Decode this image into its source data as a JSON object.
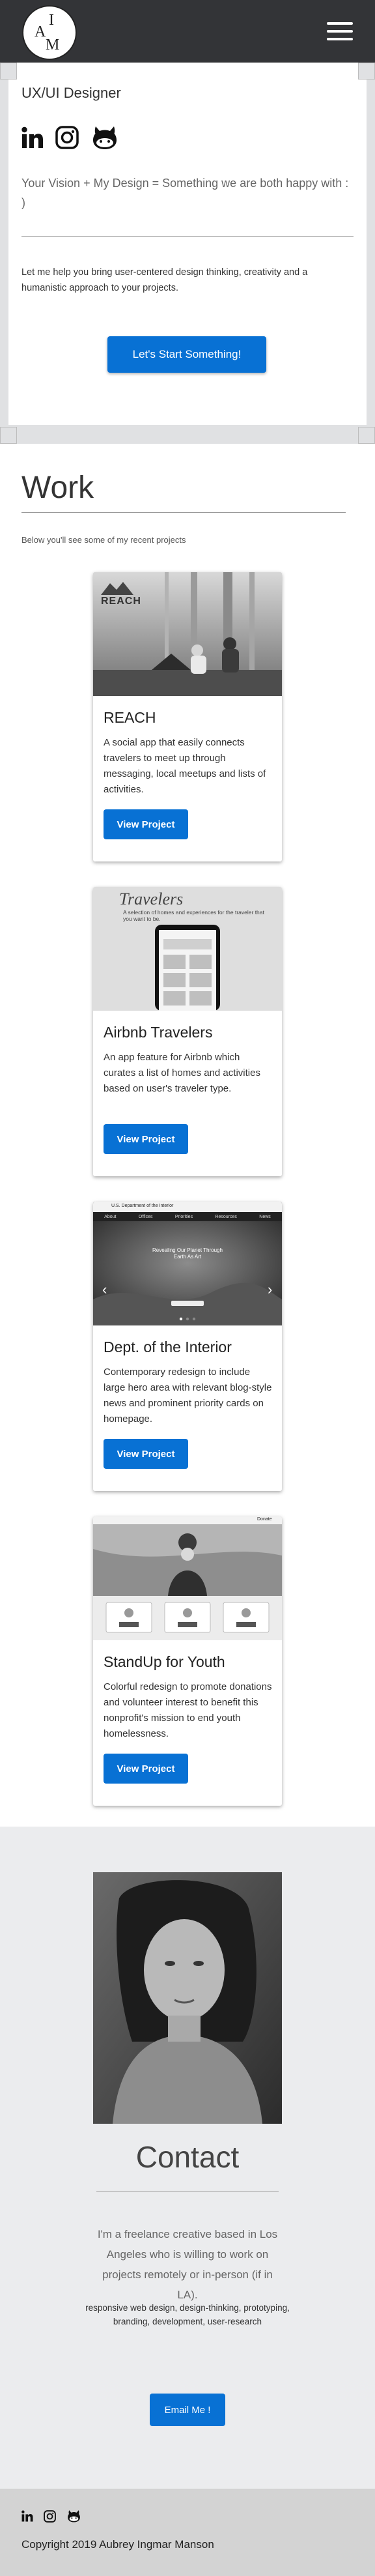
{
  "nav": {
    "logo_letters": [
      "A",
      "I",
      "M"
    ],
    "menu_icon": "hamburger-menu-icon"
  },
  "hero": {
    "title": "UX/UI Designer",
    "social_icons": [
      "linkedin-icon",
      "instagram-icon",
      "github-icon"
    ],
    "vision": "Your Vision +  My Design = Something we are both happy with : )",
    "intro": "Let me help you bring user-centered design thinking, creativity and a humanistic approach to your projects.",
    "cta": "Let's Start Something!"
  },
  "work": {
    "title": "Work",
    "subtitle": "Below you'll see some of my recent projects",
    "projects": [
      {
        "title": "REACH",
        "description": "A social app that easily connects travelers to meet up through messaging, local meetups and lists of activities.",
        "button": "View Project",
        "thumb_label": "REACH"
      },
      {
        "title": "Airbnb Travelers",
        "description": "An app feature for Airbnb which curates a list of homes and activities based on user's traveler type.",
        "button": "View Project",
        "thumb_label": "Travelers",
        "thumb_caption": "A selection of homes and experiences for the traveler that you want to be."
      },
      {
        "title": "Dept. of the Interior",
        "description": "Contemporary redesign to include large hero area with relevant blog-style news and prominent priority cards on homepage.",
        "button": "View Project",
        "thumb_label": "U.S. Department of the Interior",
        "thumb_caption": "Revealing Our Planet Through Earth As Art",
        "thumb_nav": [
          "About",
          "Offices",
          "Priorities",
          "Resources",
          "News"
        ]
      },
      {
        "title": "StandUp for Youth",
        "description": "Colorful redesign to promote donations and volunteer interest to benefit this nonprofit's mission to end youth homelessness.",
        "button": "View Project",
        "thumb_label": "Donate"
      }
    ]
  },
  "contact": {
    "title": "Contact",
    "text": "I'm a freelance creative based in Los Angeles who is willing to work on projects remotely or in-person (if in LA).",
    "skills": "responsive web design, design-thinking, prototyping, branding, development, user-research",
    "button": "Email Me !"
  },
  "footer": {
    "icons": [
      "linkedin-icon",
      "instagram-icon",
      "github-icon"
    ],
    "copyright": "Copyright 2019 Aubrey Ingmar Manson"
  },
  "colors": {
    "primary_button": "#0871d4",
    "navbar": "#333437",
    "page_background": "#ebecee"
  }
}
